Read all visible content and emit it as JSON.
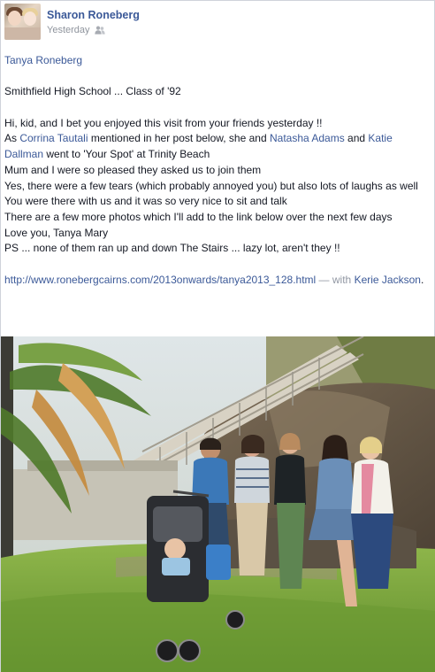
{
  "post": {
    "author": "Sharon Roneberg",
    "timestamp": "Yesterday",
    "audience_icon": "friends-icon",
    "tagged_recipient": "Tanya Roneberg",
    "school_line": "Smithfield High School ... Class of '92",
    "lines": {
      "l1": "Hi, kid, and I bet you enjoyed this visit from your friends yesterday !!",
      "l2_pre": "As ",
      "l2_friend1": "Corrina Tautali",
      "l2_mid": " mentioned in her post below, she and ",
      "l2_friend2": "Natasha Adams",
      "l2_and": " and ",
      "l2_friend3": "Katie Dallman",
      "l2_post": " went to 'Your Spot' at Trinity Beach",
      "l3": "Mum and I were so pleased they asked us to join them",
      "l4": "Yes, there were a few tears (which probably annoyed you) but also lots of laughs as well",
      "l5": "You were there with us and it was so very nice to sit and talk",
      "l6": "There are a few more photos which I'll add to the link below over the next few days",
      "l7": "Love you, Tanya Mary",
      "l8": "PS ... none of them ran up and down The Stairs ... lazy lot, aren't they !!"
    },
    "url": "http://www.ronebergcairns.com/2013onwards/tanya2013_128.html",
    "with_label": " — with ",
    "with_person": "Kerie Jackson",
    "with_end": "."
  },
  "colors": {
    "link": "#3b5998",
    "text": "#141823",
    "muted": "#9197a3"
  }
}
